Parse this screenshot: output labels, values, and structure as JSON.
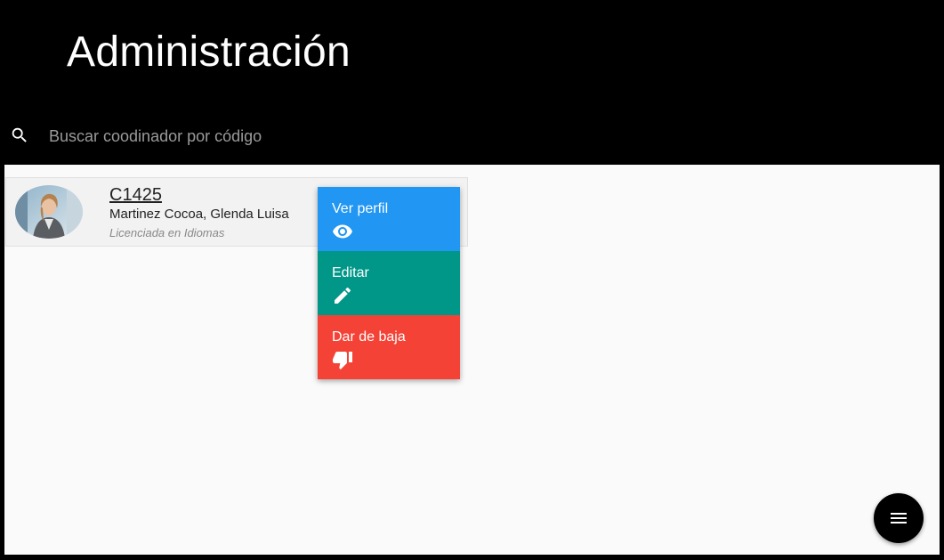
{
  "header": {
    "title": "Administración"
  },
  "search": {
    "placeholder": "Buscar coodinador por código",
    "icon": "search-icon"
  },
  "coordinator": {
    "code": "C1425",
    "name": "Martinez Cocoa, Glenda Luisa",
    "title": "Licenciada en Idiomas"
  },
  "actions": [
    {
      "label": "Ver perfil",
      "icon": "eye-icon",
      "color": "#2196f3"
    },
    {
      "label": "Editar",
      "icon": "pencil-icon",
      "color": "#009688"
    },
    {
      "label": "Dar de baja",
      "icon": "thumb-down-icon",
      "color": "#f44336"
    }
  ],
  "fab": {
    "icon": "menu-icon",
    "color": "#000000"
  },
  "colors": {
    "header_bg": "#000000",
    "content_bg": "#fafafa"
  }
}
